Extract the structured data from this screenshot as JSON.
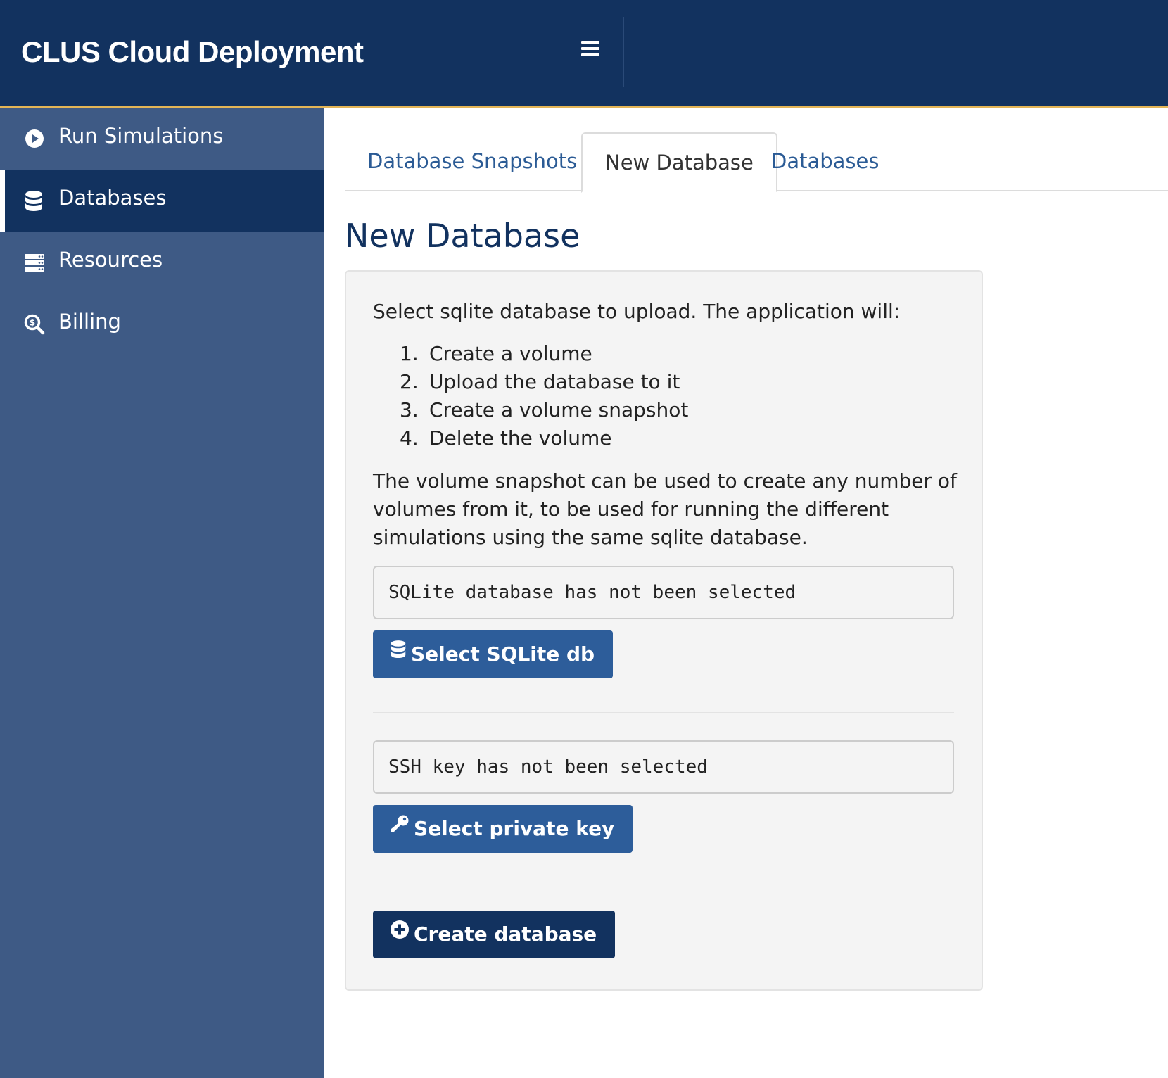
{
  "header": {
    "title": "CLUS Cloud Deployment",
    "menu_icon": "hamburger-menu-icon"
  },
  "colors": {
    "header_bg": "#12325f",
    "header_accent": "#e3b556",
    "sidebar_bg": "#3e5a85",
    "sidebar_active_bg": "#12325f",
    "link": "#2b5b95",
    "button_blue": "#2d5d9a",
    "button_navy": "#12325f"
  },
  "sidebar": {
    "items": [
      {
        "label": "Run Simulations",
        "icon": "play-circle-icon",
        "active": false
      },
      {
        "label": "Databases",
        "icon": "database-icon",
        "active": true
      },
      {
        "label": "Resources",
        "icon": "server-icon",
        "active": false
      },
      {
        "label": "Billing",
        "icon": "search-dollar-icon",
        "active": false
      }
    ]
  },
  "tabs": [
    {
      "label": "Database Snapshots",
      "active": false
    },
    {
      "label": "New Database",
      "active": true
    },
    {
      "label": "Databases",
      "active": false
    }
  ],
  "main": {
    "title": "New Database",
    "intro": "Select sqlite database to upload. The application will:",
    "steps": [
      {
        "num": "1.",
        "text": "Create a volume"
      },
      {
        "num": "2.",
        "text": "Upload the database to it"
      },
      {
        "num": "3.",
        "text": "Create a volume snapshot"
      },
      {
        "num": "4.",
        "text": "Delete the volume"
      }
    ],
    "description": "The volume snapshot can be used to create any number of volumes from it, to be used for running the different simulations using the same sqlite database.",
    "sqlite_status": "SQLite database has not been selected",
    "select_sqlite_button": "Select SQLite db",
    "ssh_status": "SSH key has not been selected",
    "select_key_button": "Select private key",
    "create_button": "Create database"
  }
}
